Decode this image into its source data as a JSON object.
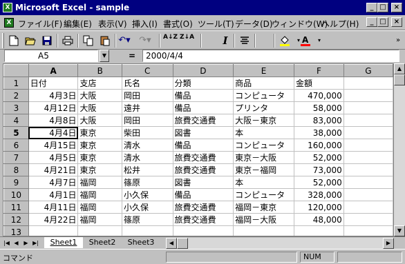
{
  "window": {
    "title": "Microsoft Excel - sample",
    "app_icon": "excel-icon",
    "minimize": "_",
    "maximize": "□",
    "close": "×"
  },
  "menu": {
    "items": [
      "ファイル(F)",
      "編集(E)",
      "表示(V)",
      "挿入(I)",
      "書式(O)",
      "ツール(T)",
      "データ(D)",
      "ウィンドウ(W)",
      "ヘルプ(H)"
    ]
  },
  "toolbar": {
    "icons": [
      "new-icon",
      "open-icon",
      "save-icon",
      "print-icon",
      "copy-icon",
      "paste-icon",
      "undo-icon",
      "redo-icon",
      "sort-asc-icon",
      "sort-desc-icon",
      "italic-icon",
      "align-center-icon",
      "fill-color-icon",
      "font-color-icon"
    ],
    "italic_label": "I",
    "sort_asc_label": "A↓Z",
    "sort_desc_label": "Z↓A"
  },
  "formula_bar": {
    "cell_ref": "A5",
    "equals": "=",
    "value": "2000/4/4"
  },
  "grid": {
    "columns": [
      "A",
      "B",
      "C",
      "D",
      "E",
      "F",
      "G"
    ],
    "active_column": "A",
    "active_row": 5,
    "rows": [
      {
        "n": "1",
        "cells": [
          "日付",
          "支店",
          "氏名",
          "分類",
          "商品",
          "金額",
          ""
        ]
      },
      {
        "n": "2",
        "cells": [
          "4月3日",
          "大阪",
          "岡田",
          "備品",
          "コンピュータ",
          "470,000",
          ""
        ]
      },
      {
        "n": "3",
        "cells": [
          "4月12日",
          "大阪",
          "遠井",
          "備品",
          "プリンタ",
          "58,000",
          ""
        ]
      },
      {
        "n": "4",
        "cells": [
          "4月8日",
          "大阪",
          "岡田",
          "旅費交通費",
          "大阪－東京",
          "83,000",
          ""
        ]
      },
      {
        "n": "5",
        "cells": [
          "4月4日",
          "東京",
          "柴田",
          "図書",
          "本",
          "38,000",
          ""
        ]
      },
      {
        "n": "6",
        "cells": [
          "4月15日",
          "東京",
          "清水",
          "備品",
          "コンピュータ",
          "160,000",
          ""
        ]
      },
      {
        "n": "7",
        "cells": [
          "4月5日",
          "東京",
          "清水",
          "旅費交通費",
          "東京－大阪",
          "52,000",
          ""
        ]
      },
      {
        "n": "8",
        "cells": [
          "4月21日",
          "東京",
          "松井",
          "旅費交通費",
          "東京－福岡",
          "73,000",
          ""
        ]
      },
      {
        "n": "9",
        "cells": [
          "4月7日",
          "福岡",
          "篠原",
          "図書",
          "本",
          "52,000",
          ""
        ]
      },
      {
        "n": "10",
        "cells": [
          "4月1日",
          "福岡",
          "小久保",
          "備品",
          "コンピュータ",
          "328,000",
          ""
        ]
      },
      {
        "n": "11",
        "cells": [
          "4月11日",
          "福岡",
          "小久保",
          "旅費交通費",
          "福岡－東京",
          "120,000",
          ""
        ]
      },
      {
        "n": "12",
        "cells": [
          "4月22日",
          "福岡",
          "篠原",
          "旅費交通費",
          "福岡－大阪",
          "48,000",
          ""
        ]
      },
      {
        "n": "13",
        "cells": [
          "",
          "",
          "",
          "",
          "",
          "",
          ""
        ]
      }
    ]
  },
  "sheets": {
    "tabs": [
      "Sheet1",
      "Sheet2",
      "Sheet3"
    ],
    "active": "Sheet1"
  },
  "status": {
    "text": "コマンド",
    "num": "NUM"
  },
  "colors": {
    "titlebar": "#000080",
    "chrome": "#c0c0c0",
    "excel_green": "#1f7a1f"
  }
}
